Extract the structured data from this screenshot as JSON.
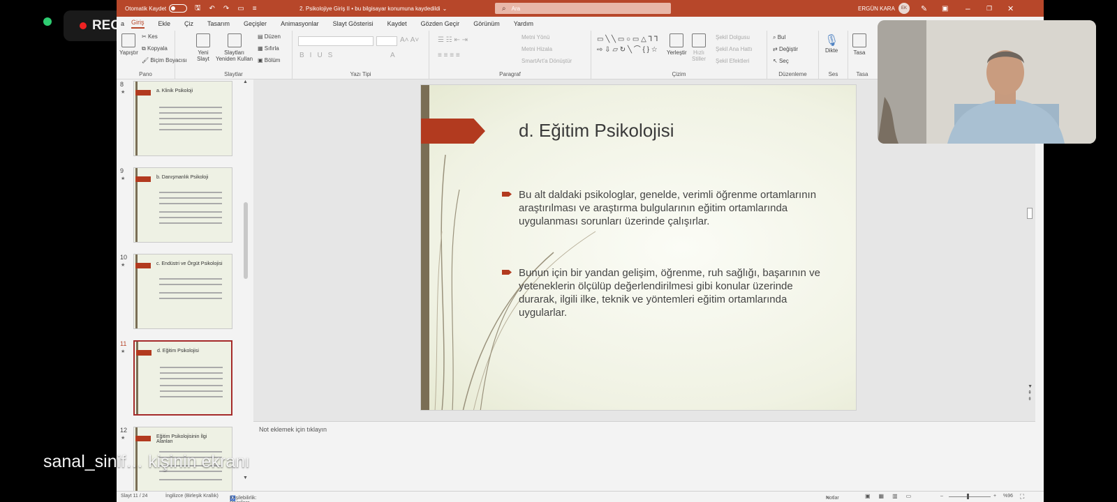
{
  "overlay": {
    "rec_label": "REC",
    "caption": "sanal_sinif… kişinin ekranı"
  },
  "titlebar": {
    "autosave_label": "Otomatik Kaydet",
    "doc_title": "2. Psikolojiye Giriş II  •  bu bilgisayar konumuna kaydedildi",
    "search_placeholder": "Ara",
    "user_name": "ERGÜN KARA",
    "user_initials": "EK"
  },
  "menu": {
    "items": [
      "a",
      "Giriş",
      "Ekle",
      "Çiz",
      "Tasarım",
      "Geçişler",
      "Animasyonlar",
      "Slayt Gösterisi",
      "Kaydet",
      "Gözden Geçir",
      "Görünüm",
      "Yardım"
    ],
    "active": "Giriş"
  },
  "ribbon": {
    "pano": {
      "label": "Pano",
      "paste": "Yapıştır",
      "cut": "Kes",
      "copy": "Kopyala",
      "format_painter": "Biçim Boyacısı"
    },
    "slaytlar": {
      "label": "Slaytlar",
      "new_slide": "Yeni",
      "new_slide2": "Slayt",
      "reuse": "Slaytları",
      "reuse2": "Yeniden Kullan",
      "layout": "Düzen",
      "reset": "Sıfırla",
      "section": "Bölüm"
    },
    "yazi_tipi": {
      "label": "Yazı Tipi"
    },
    "paragraf": {
      "label": "Paragraf",
      "text_direction": "Metni Yönü",
      "align_text": "Metni Hizala",
      "smartart": "SmartArt'a Dönüştür"
    },
    "cizim": {
      "label": "Çizim",
      "arrange": "Yerleştir",
      "quick_styles": "Hızlı",
      "quick_styles2": "Stiller",
      "shape_fill": "Şekil Dolgusu",
      "shape_outline": "Şekil Ana Hattı",
      "shape_effects": "Şekil Efektleri"
    },
    "duzenleme": {
      "label": "Düzenleme",
      "find": "Bul",
      "replace": "Değiştir",
      "select": "Seç"
    },
    "ses": {
      "label": "Ses",
      "dictate": "Dikte"
    },
    "tasarimci": {
      "label": "Tasa",
      "label2": "Tasa"
    }
  },
  "thumbnails": [
    {
      "num": "8",
      "title": "a. Klinik Psikoloji",
      "selected": false
    },
    {
      "num": "9",
      "title": "b. Danışmanlık Psikoloji",
      "selected": false
    },
    {
      "num": "10",
      "title": "c. Endüstri ve Örgüt Psikolojisi",
      "selected": false
    },
    {
      "num": "11",
      "title": "d. Eğitim Psikolojisi",
      "selected": true
    },
    {
      "num": "12",
      "title": "Eğitim Psikolojisinin İlgi Alanları",
      "selected": false
    }
  ],
  "slide": {
    "title": "d. Eğitim Psikolojisi",
    "bullets": [
      "Bu alt daldaki psikologlar, genelde, verimli öğrenme ortamlarının araştırılması ve araştırma bulgularının eğitim ortamlarında uygulanması sorunları üzerinde çalışırlar.",
      "Bunun için bir yandan gelişim, öğrenme, ruh sağlığı, başarının ve yeteneklerin ölçülüp değerlendirilmesi gibi konular üzerinde durarak, ilgili ilke, teknik ve yöntemleri eğitim ortamlarında uygularlar."
    ]
  },
  "notes": {
    "placeholder": "Not eklemek için tıklayın"
  },
  "status": {
    "slide_counter": "Slayt 11 / 24",
    "language": "İngilizce (Birleşik Krallık)",
    "accessibility": "Erişilebilirlik: Önerilere göz atın",
    "notes_btn": "Notlar",
    "zoom": "%96"
  },
  "colors": {
    "accent": "#b7472a",
    "slide_arrow": "#b23a1f",
    "slide_bar": "#7a6e55"
  }
}
